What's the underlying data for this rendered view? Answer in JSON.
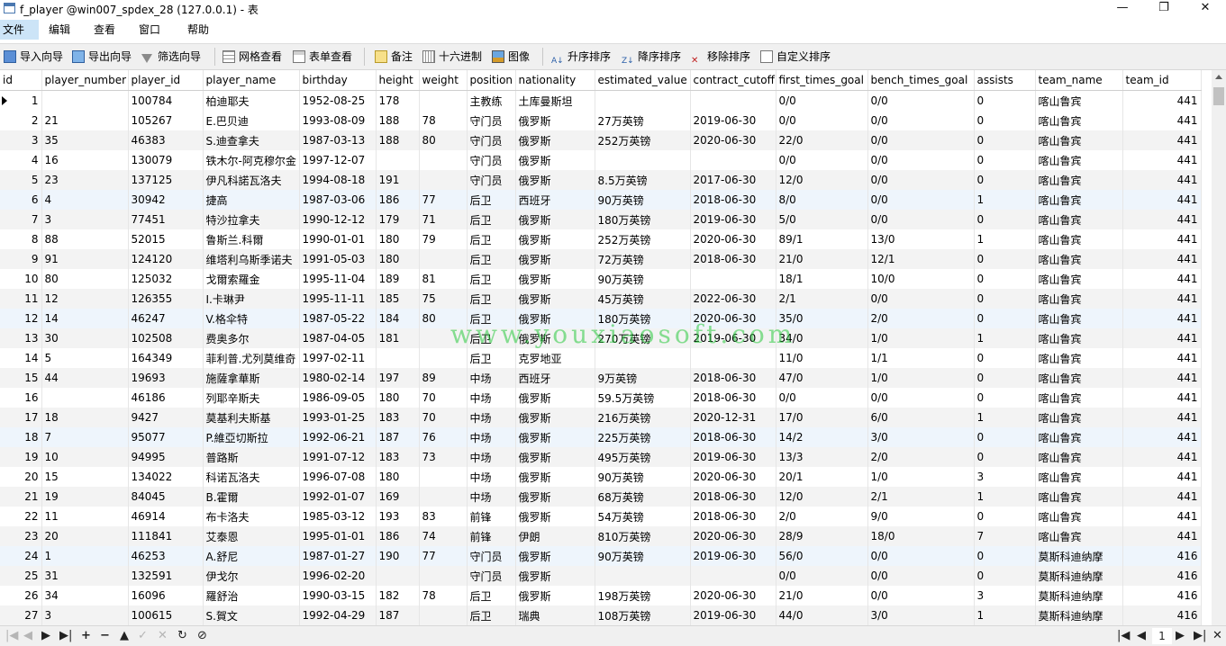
{
  "window": {
    "title": "f_player @win007_spdex_28 (127.0.0.1) - 表",
    "minimize_glyph": "—",
    "maximize_glyph": "❐",
    "close_glyph": "✕"
  },
  "menu": [
    "文件",
    "编辑",
    "查看",
    "窗口",
    "帮助"
  ],
  "toolbar": {
    "import": "导入向导",
    "export": "导出向导",
    "filter": "筛选向导",
    "grid_view": "网格查看",
    "form_view": "表单查看",
    "memo": "备注",
    "hex": "十六进制",
    "image": "图像",
    "sort_asc": "升序排序",
    "sort_desc": "降序排序",
    "remove_sort": "移除排序",
    "custom_sort": "自定义排序"
  },
  "columns": [
    "id",
    "player_number",
    "player_id",
    "player_name",
    "birthday",
    "height",
    "weight",
    "position",
    "nationality",
    "estimated_value",
    "contract_cutoff",
    "first_times_goal",
    "bench_times_goal",
    "assists",
    "team_name",
    "team_id"
  ],
  "rows": [
    [
      "1",
      "",
      "100784",
      "柏迪耶夫",
      "1952-08-25",
      "178",
      "",
      "主教练",
      "土库曼斯坦",
      "",
      "",
      "0/0",
      "0/0",
      "0",
      "喀山鲁宾",
      "441"
    ],
    [
      "2",
      "21",
      "105267",
      "E.巴贝迪",
      "1993-08-09",
      "188",
      "78",
      "守门员",
      "俄罗斯",
      "27万英镑",
      "2019-06-30",
      "0/0",
      "0/0",
      "0",
      "喀山鲁宾",
      "441"
    ],
    [
      "3",
      "35",
      "46383",
      "S.迪查拿夫",
      "1987-03-13",
      "188",
      "80",
      "守门员",
      "俄罗斯",
      "252万英镑",
      "2020-06-30",
      "22/0",
      "0/0",
      "0",
      "喀山鲁宾",
      "441"
    ],
    [
      "4",
      "16",
      "130079",
      "铁木尔-阿克穆尔金",
      "1997-12-07",
      "",
      "",
      "守门员",
      "俄罗斯",
      "",
      "",
      "0/0",
      "0/0",
      "0",
      "喀山鲁宾",
      "441"
    ],
    [
      "5",
      "23",
      "137125",
      "伊凡科諾瓦洛夫",
      "1994-08-18",
      "191",
      "",
      "守门员",
      "俄罗斯",
      "8.5万英镑",
      "2017-06-30",
      "12/0",
      "0/0",
      "0",
      "喀山鲁宾",
      "441"
    ],
    [
      "6",
      "4",
      "30942",
      "捷高",
      "1987-03-06",
      "186",
      "77",
      "后卫",
      "西班牙",
      "90万英镑",
      "2018-06-30",
      "8/0",
      "0/0",
      "1",
      "喀山鲁宾",
      "441"
    ],
    [
      "7",
      "3",
      "77451",
      "特沙拉拿夫",
      "1990-12-12",
      "179",
      "71",
      "后卫",
      "俄罗斯",
      "180万英镑",
      "2019-06-30",
      "5/0",
      "0/0",
      "0",
      "喀山鲁宾",
      "441"
    ],
    [
      "8",
      "88",
      "52015",
      "鲁斯兰.科爾",
      "1990-01-01",
      "180",
      "79",
      "后卫",
      "俄罗斯",
      "252万英镑",
      "2020-06-30",
      "89/1",
      "13/0",
      "1",
      "喀山鲁宾",
      "441"
    ],
    [
      "9",
      "91",
      "124120",
      "维塔利乌斯季诺夫",
      "1991-05-03",
      "180",
      "",
      "后卫",
      "俄罗斯",
      "72万英镑",
      "2018-06-30",
      "21/0",
      "12/1",
      "0",
      "喀山鲁宾",
      "441"
    ],
    [
      "10",
      "80",
      "125032",
      "戈爾索羅金",
      "1995-11-04",
      "189",
      "81",
      "后卫",
      "俄罗斯",
      "90万英镑",
      "",
      "18/1",
      "10/0",
      "0",
      "喀山鲁宾",
      "441"
    ],
    [
      "11",
      "12",
      "126355",
      "I.卡琳尹",
      "1995-11-11",
      "185",
      "75",
      "后卫",
      "俄罗斯",
      "45万英镑",
      "2022-06-30",
      "2/1",
      "0/0",
      "0",
      "喀山鲁宾",
      "441"
    ],
    [
      "12",
      "14",
      "46247",
      "V.格伞特",
      "1987-05-22",
      "184",
      "80",
      "后卫",
      "俄罗斯",
      "180万英镑",
      "2020-06-30",
      "35/0",
      "2/0",
      "0",
      "喀山鲁宾",
      "441"
    ],
    [
      "13",
      "30",
      "102508",
      "费奥多尔",
      "1987-04-05",
      "181",
      "",
      "后卫",
      "俄罗斯",
      "270万英镑",
      "2019-06-30",
      "34/0",
      "1/0",
      "1",
      "喀山鲁宾",
      "441"
    ],
    [
      "14",
      "5",
      "164349",
      "菲利普.尤列莫维奇",
      "1997-02-11",
      "",
      "",
      "后卫",
      "克罗地亚",
      "",
      "",
      "11/0",
      "1/1",
      "0",
      "喀山鲁宾",
      "441"
    ],
    [
      "15",
      "44",
      "19693",
      "施薩拿華斯",
      "1980-02-14",
      "197",
      "89",
      "中场",
      "西班牙",
      "9万英镑",
      "2018-06-30",
      "47/0",
      "1/0",
      "0",
      "喀山鲁宾",
      "441"
    ],
    [
      "16",
      "",
      "46186",
      "列耶辛斯夫",
      "1986-09-05",
      "180",
      "70",
      "中场",
      "俄罗斯",
      "59.5万英镑",
      "2018-06-30",
      "0/0",
      "0/0",
      "0",
      "喀山鲁宾",
      "441"
    ],
    [
      "17",
      "18",
      "9427",
      "莫基利夫斯基",
      "1993-01-25",
      "183",
      "70",
      "中场",
      "俄罗斯",
      "216万英镑",
      "2020-12-31",
      "17/0",
      "6/0",
      "1",
      "喀山鲁宾",
      "441"
    ],
    [
      "18",
      "7",
      "95077",
      "P.維亞切斯拉",
      "1992-06-21",
      "187",
      "76",
      "中场",
      "俄罗斯",
      "225万英镑",
      "2018-06-30",
      "14/2",
      "3/0",
      "0",
      "喀山鲁宾",
      "441"
    ],
    [
      "19",
      "10",
      "94995",
      "普路斯",
      "1991-07-12",
      "183",
      "73",
      "中场",
      "俄罗斯",
      "495万英镑",
      "2019-06-30",
      "13/3",
      "2/0",
      "0",
      "喀山鲁宾",
      "441"
    ],
    [
      "20",
      "15",
      "134022",
      "科诺瓦洛夫",
      "1996-07-08",
      "180",
      "",
      "中场",
      "俄罗斯",
      "90万英镑",
      "2020-06-30",
      "20/1",
      "1/0",
      "3",
      "喀山鲁宾",
      "441"
    ],
    [
      "21",
      "19",
      "84045",
      "B.霍爾",
      "1992-01-07",
      "169",
      "",
      "中场",
      "俄罗斯",
      "68万英镑",
      "2018-06-30",
      "12/0",
      "2/1",
      "1",
      "喀山鲁宾",
      "441"
    ],
    [
      "22",
      "11",
      "46914",
      "布卡洛夫",
      "1985-03-12",
      "193",
      "83",
      "前锋",
      "俄罗斯",
      "54万英镑",
      "2018-06-30",
      "2/0",
      "9/0",
      "0",
      "喀山鲁宾",
      "441"
    ],
    [
      "23",
      "20",
      "111841",
      "艾泰恩",
      "1995-01-01",
      "186",
      "74",
      "前锋",
      "伊朗",
      "810万英镑",
      "2020-06-30",
      "28/9",
      "18/0",
      "7",
      "喀山鲁宾",
      "441"
    ],
    [
      "24",
      "1",
      "46253",
      "A.舒尼",
      "1987-01-27",
      "190",
      "77",
      "守门员",
      "俄罗斯",
      "90万英镑",
      "2019-06-30",
      "56/0",
      "0/0",
      "0",
      "莫斯科迪纳摩",
      "416"
    ],
    [
      "25",
      "31",
      "132591",
      "伊戈尔",
      "1996-02-20",
      "",
      "",
      "守门员",
      "俄罗斯",
      "",
      "",
      "0/0",
      "0/0",
      "0",
      "莫斯科迪纳摩",
      "416"
    ],
    [
      "26",
      "34",
      "16096",
      "羅舒治",
      "1990-03-15",
      "182",
      "78",
      "后卫",
      "俄罗斯",
      "198万英镑",
      "2020-06-30",
      "21/0",
      "0/0",
      "3",
      "莫斯科迪纳摩",
      "416"
    ],
    [
      "27",
      "3",
      "100615",
      "S.賀文",
      "1992-04-29",
      "187",
      "",
      "后卫",
      "瑞典",
      "108万英镑",
      "2019-06-30",
      "44/0",
      "3/0",
      "1",
      "莫斯科迪纳摩",
      "416"
    ]
  ],
  "status": {
    "page": "1"
  },
  "watermark": "www.youxiaosoft.com"
}
